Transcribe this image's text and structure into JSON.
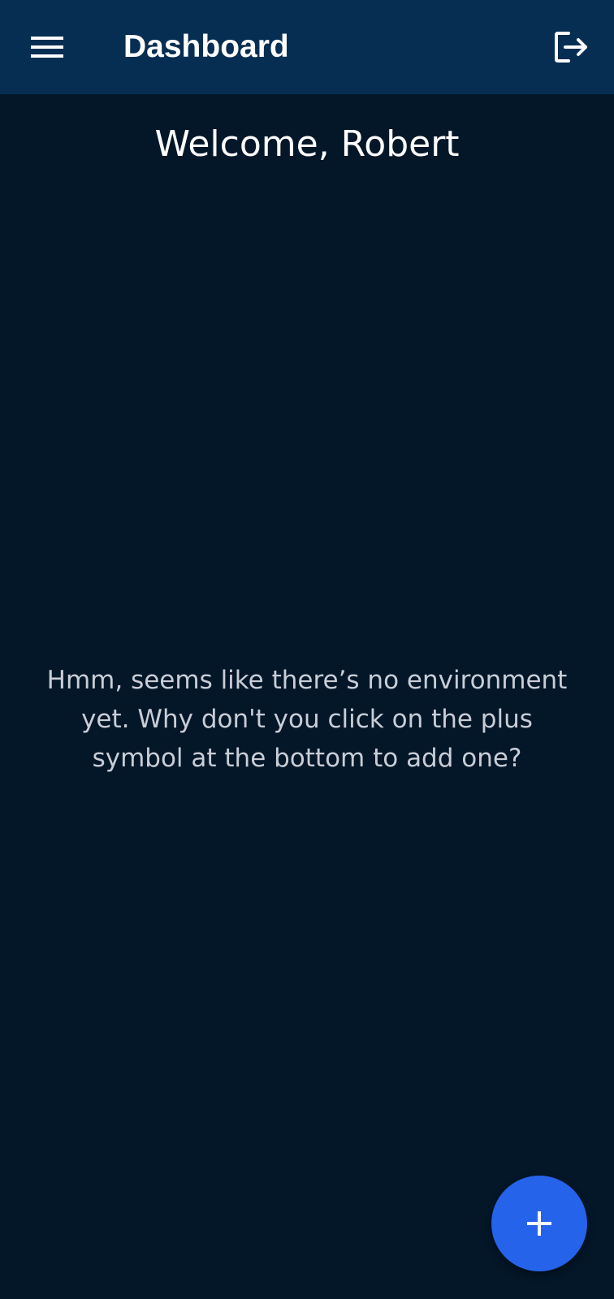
{
  "app_bar": {
    "title": "Dashboard",
    "menu_icon": "menu-icon",
    "logout_icon": "logout-icon"
  },
  "main": {
    "welcome_text": "Welcome, Robert",
    "empty_state_message": "Hmm, seems like there’s no environment yet. Why don't you click on the plus symbol at the bottom to add one?"
  },
  "fab": {
    "icon": "plus-icon"
  },
  "colors": {
    "background": "#031729",
    "app_bar": "#062e52",
    "fab": "#2563eb",
    "message_text": "#c9cdd6"
  }
}
